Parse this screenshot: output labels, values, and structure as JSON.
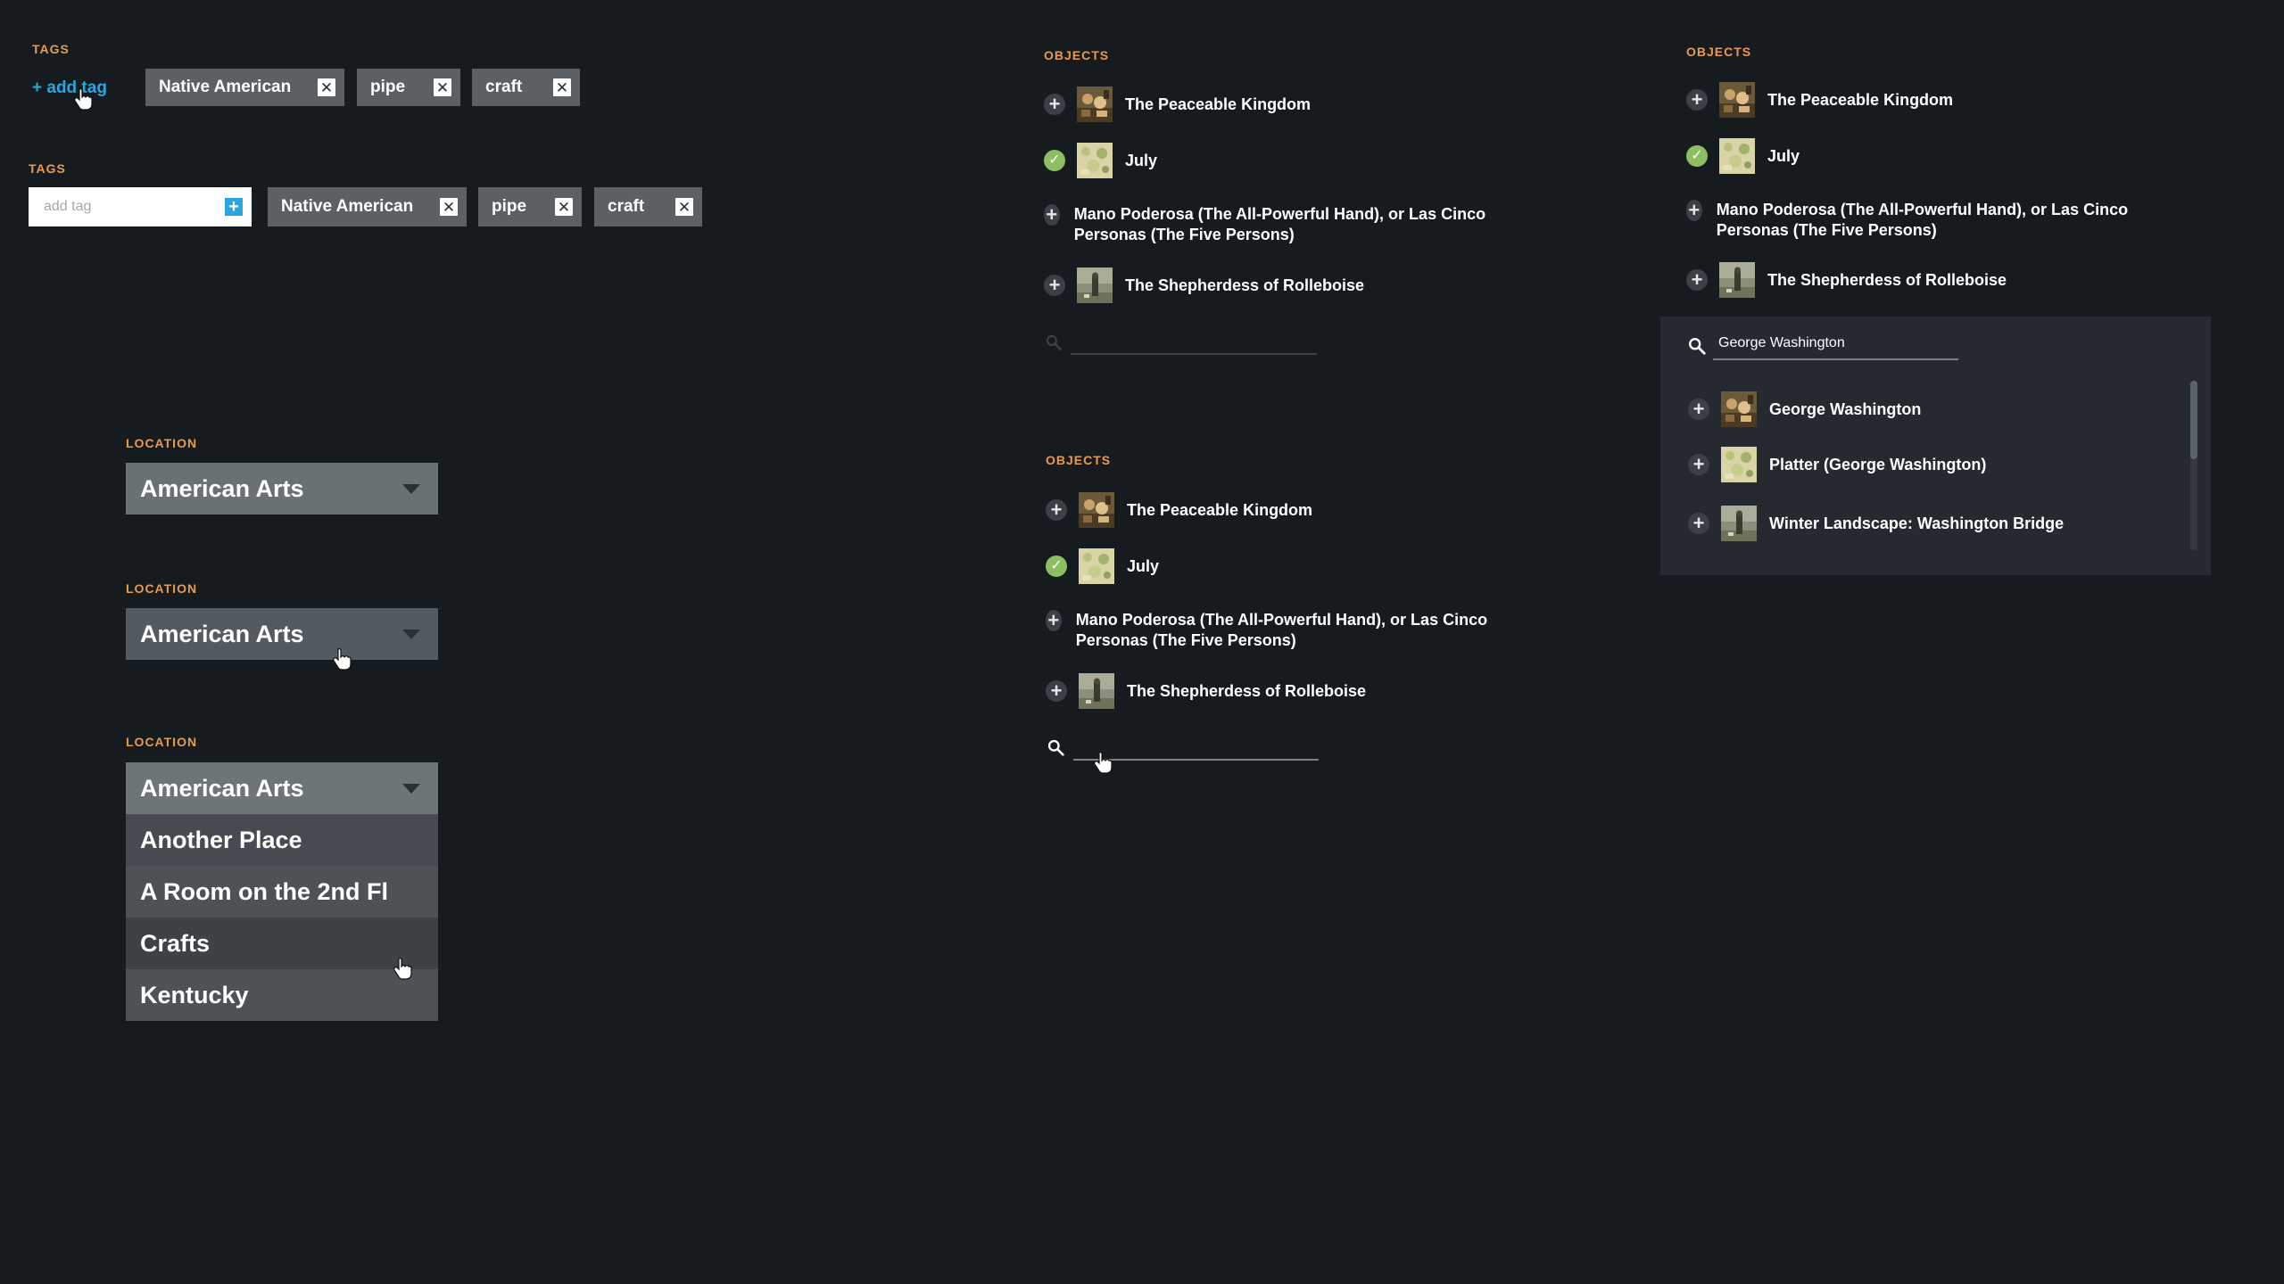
{
  "tags_a": {
    "label": "TAGS",
    "add_link": "+ add tag",
    "tags": [
      "Native American",
      "pipe",
      "craft"
    ]
  },
  "tags_b": {
    "label": "TAGS",
    "input_placeholder": "add tag",
    "tags": [
      "Native American",
      "pipe",
      "craft"
    ]
  },
  "location_a": {
    "label": "LOCATION",
    "value": "American Arts"
  },
  "location_b": {
    "label": "LOCATION",
    "value": "American Arts"
  },
  "location_c": {
    "label": "LOCATION",
    "value": "American Arts",
    "options": [
      "Another Place",
      "A Room on the 2nd Fl",
      "Crafts",
      "Kentucky"
    ]
  },
  "objects_a": {
    "label": "OBJECTS",
    "items": [
      {
        "title": "The Peaceable Kingdom",
        "state": "add",
        "thumb": "peaceable-thumb"
      },
      {
        "title": "July",
        "state": "added",
        "thumb": "july-thumb"
      },
      {
        "title": "Mano Poderosa (The All-Powerful Hand), or Las Cinco Personas (The Five Persons)",
        "state": "add",
        "thumb": ""
      },
      {
        "title": "The Shepherdess of Rolleboise",
        "state": "add",
        "thumb": "shepherdess-thumb"
      }
    ]
  },
  "objects_b": {
    "label": "OBJECTS",
    "items": [
      {
        "title": "The Peaceable Kingdom",
        "state": "add",
        "thumb": "peaceable-thumb"
      },
      {
        "title": "July",
        "state": "added",
        "thumb": "july-thumb"
      },
      {
        "title": "Mano Poderosa (The All-Powerful Hand), or Las Cinco Personas (The Five Persons)",
        "state": "add",
        "thumb": ""
      },
      {
        "title": "The Shepherdess of Rolleboise",
        "state": "add",
        "thumb": "shepherdess-thumb"
      }
    ]
  },
  "objects_c": {
    "label": "OBJECTS",
    "items": [
      {
        "title": "The Peaceable Kingdom",
        "state": "add",
        "thumb": "peaceable-thumb"
      },
      {
        "title": "July",
        "state": "added",
        "thumb": "july-thumb"
      },
      {
        "title": "Mano Poderosa (The All-Powerful Hand), or Las Cinco Personas (The Five Persons)",
        "state": "add",
        "thumb": ""
      },
      {
        "title": "The Shepherdess of Rolleboise",
        "state": "add",
        "thumb": "shepherdess-thumb"
      }
    ],
    "search_value": "George Washington",
    "results": [
      {
        "title": "George Washington",
        "thumb": "peaceable-thumb"
      },
      {
        "title": "Platter (George Washington)",
        "thumb": "july-thumb"
      },
      {
        "title": "Winter Landscape: Washington Bridge",
        "thumb": "shepherdess-thumb"
      }
    ]
  },
  "colors": {
    "background": "#161b1f",
    "accent_label": "#e99a4c",
    "link_blue": "#2aa6df",
    "check_green": "#8dbf62",
    "tag_gray": "#5a6064"
  }
}
